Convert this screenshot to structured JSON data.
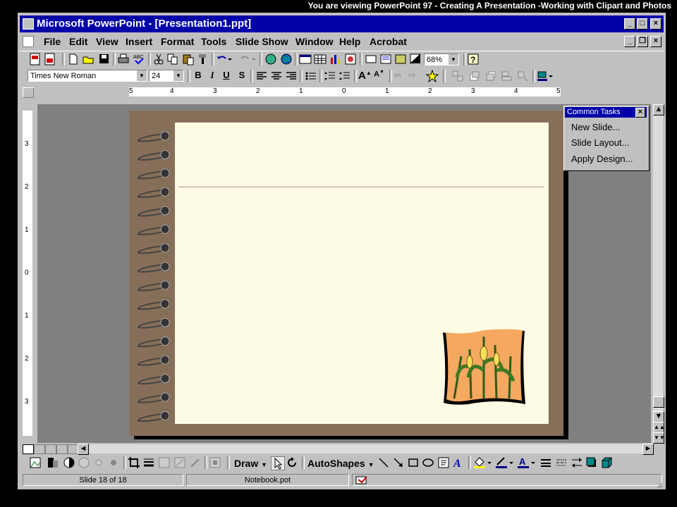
{
  "caption": "You are viewing PowerPoint 97 -  Creating A Presentation  -Working with Clipart and Photos",
  "window": {
    "title": "Microsoft PowerPoint - [Presentation1.ppt]"
  },
  "menu": [
    "File",
    "Edit",
    "View",
    "Insert",
    "Format",
    "Tools",
    "Slide Show",
    "Window",
    "Help",
    "Acrobat"
  ],
  "standard_toolbar": {
    "zoom": "68%"
  },
  "formatting_toolbar": {
    "font": "Times New Roman",
    "size": "24"
  },
  "ruler": {
    "h_labels": [
      "5",
      "4",
      "3",
      "2",
      "1",
      "0",
      "1",
      "2",
      "3",
      "4",
      "5"
    ],
    "v_labels": [
      "3",
      "2",
      "1",
      "0",
      "1",
      "2",
      "3"
    ]
  },
  "common_tasks": {
    "title": "Common Tasks",
    "items": [
      "New Slide...",
      "Slide Layout...",
      "Apply Design..."
    ]
  },
  "drawing_toolbar": {
    "draw": "Draw",
    "autoshapes": "AutoShapes"
  },
  "status": {
    "slide": "Slide 18 of 18",
    "design": "Notebook.pot"
  },
  "colors": {
    "title_bar": "#0000a8",
    "chrome": "#c0c0c0",
    "slide_border": "#876e58",
    "paper": "#fdfbe3"
  }
}
